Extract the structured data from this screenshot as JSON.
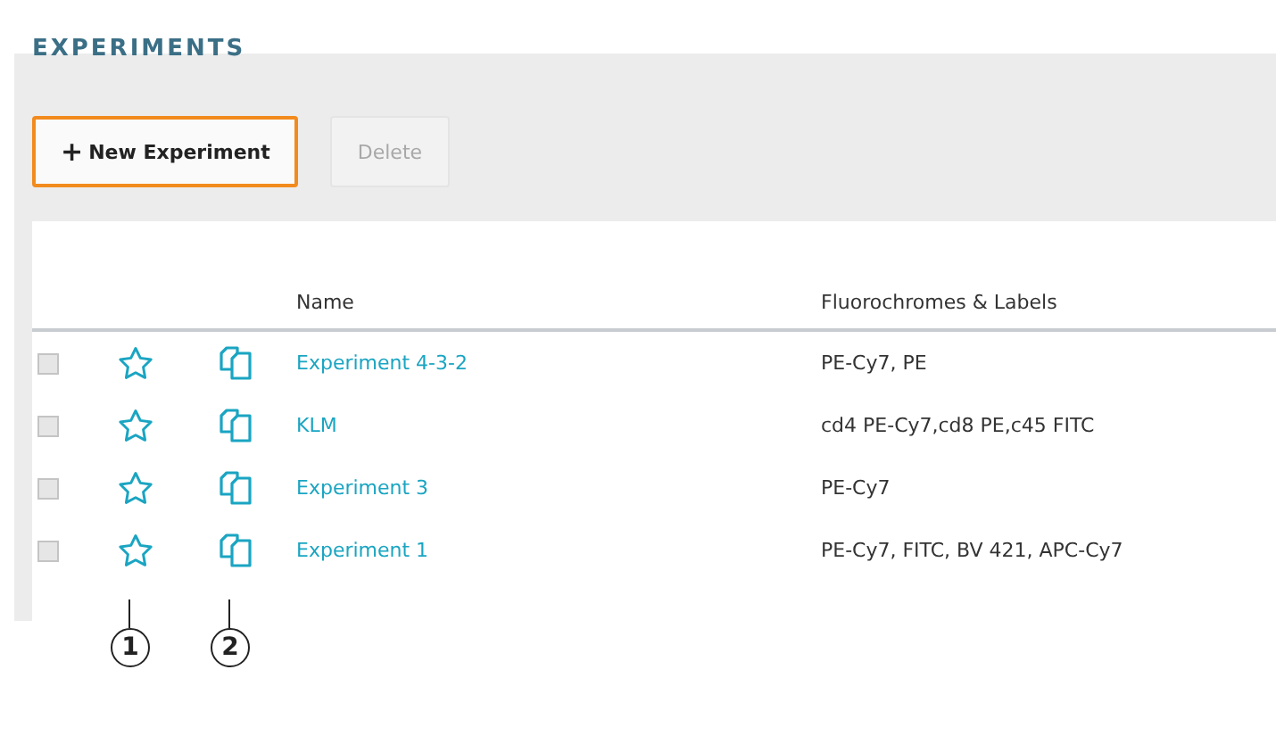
{
  "page": {
    "title": "EXPERIMENTS"
  },
  "toolbar": {
    "buttons": [
      {
        "label": "New Experiment",
        "icon": "+",
        "disabled": false,
        "focused": true
      },
      {
        "label": "Delete",
        "disabled": true,
        "focused": false
      }
    ]
  },
  "table": {
    "columns": [
      "Name",
      "Fluorochromes & Labels"
    ],
    "rows": [
      {
        "checked": false,
        "favorite": false,
        "name": "Experiment 4-3-2",
        "labels": "PE-Cy7, PE"
      },
      {
        "checked": false,
        "favorite": false,
        "name": "KLM",
        "labels": "cd4 PE-Cy7,cd8 PE,c45 FITC"
      },
      {
        "checked": false,
        "favorite": false,
        "name": "Experiment 3",
        "labels": "PE-Cy7"
      },
      {
        "checked": false,
        "favorite": false,
        "name": "Experiment 1",
        "labels": "PE-Cy7, FITC, BV 421, APC-Cy7"
      }
    ]
  },
  "callouts": [
    "1",
    "2"
  ]
}
